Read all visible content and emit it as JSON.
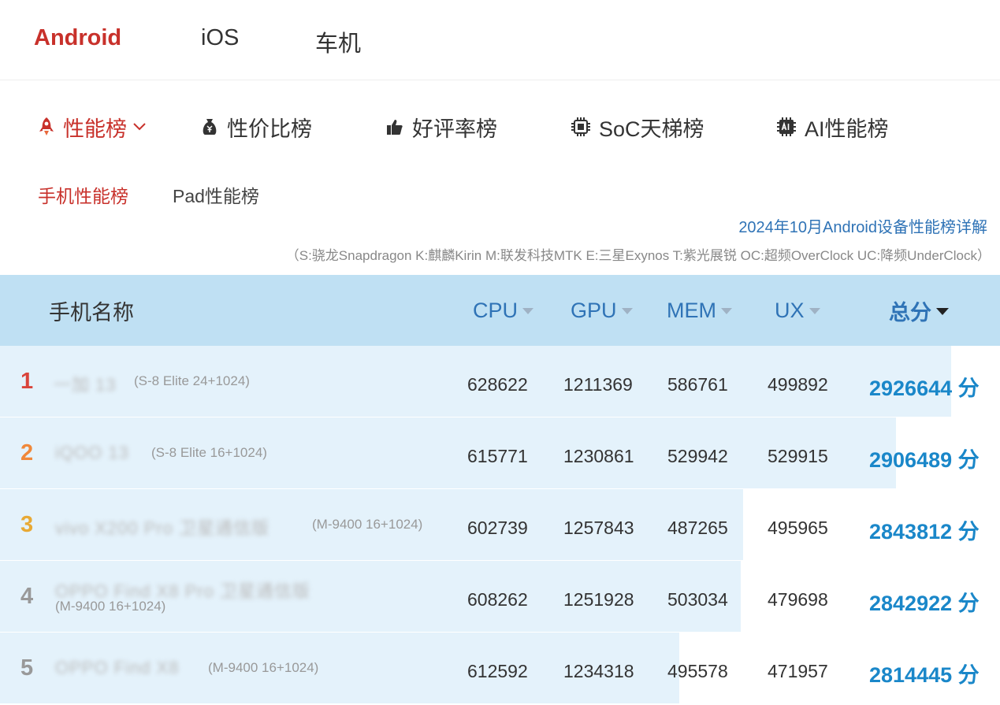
{
  "platforms": [
    "Android",
    "iOS",
    "车机"
  ],
  "categories": [
    "性能榜",
    "性价比榜",
    "好评率榜",
    "SoC天梯榜",
    "AI性能榜"
  ],
  "sub_tabs": [
    "手机性能榜",
    "Pad性能榜"
  ],
  "detail_link": "2024年10月Android设备性能榜详解",
  "legend_note": "（S:骁龙Snapdragon K:麒麟Kirin M:联发科技MTK E:三星Exynos T:紫光展锐 OC:超频OverClock UC:降频UnderClock）",
  "columns": {
    "name": "手机名称",
    "cpu": "CPU",
    "gpu": "GPU",
    "mem": "MEM",
    "ux": "UX",
    "total": "总分"
  },
  "colors": {
    "accent_red": "#c8312b",
    "link_blue": "#2f73b6",
    "score_blue": "#1a87c9",
    "header_bg": "#bfe0f3",
    "row_bar": "#e4f2fb",
    "rank1": "#d9443b",
    "rank2": "#f0883a",
    "rank3": "#e8a935",
    "rank_other": "#999999"
  },
  "rows": [
    {
      "rank": "1",
      "name": "一加 13",
      "spec": "(S-8 Elite 24+1024)",
      "cpu": "628622",
      "gpu": "1211369",
      "mem": "586761",
      "ux": "499892",
      "total": "2926644 分",
      "total_value": 2926644
    },
    {
      "rank": "2",
      "name": "iQOO 13",
      "spec": "(S-8 Elite 16+1024)",
      "cpu": "615771",
      "gpu": "1230861",
      "mem": "529942",
      "ux": "529915",
      "total": "2906489 分",
      "total_value": 2906489
    },
    {
      "rank": "3",
      "name": "vivo X200 Pro 卫星通信版",
      "spec": "(M-9400 16+1024)",
      "cpu": "602739",
      "gpu": "1257843",
      "mem": "487265",
      "ux": "495965",
      "total": "2843812 分",
      "total_value": 2843812
    },
    {
      "rank": "4",
      "name": "OPPO Find X8 Pro 卫星通信版",
      "spec": "(M-9400 16+1024)",
      "cpu": "608262",
      "gpu": "1251928",
      "mem": "503034",
      "ux": "479698",
      "total": "2842922 分",
      "total_value": 2842922
    },
    {
      "rank": "5",
      "name": "OPPO Find X8",
      "spec": "(M-9400 16+1024)",
      "cpu": "612592",
      "gpu": "1234318",
      "mem": "495578",
      "ux": "471957",
      "total": "2814445 分",
      "total_value": 2814445
    }
  ]
}
